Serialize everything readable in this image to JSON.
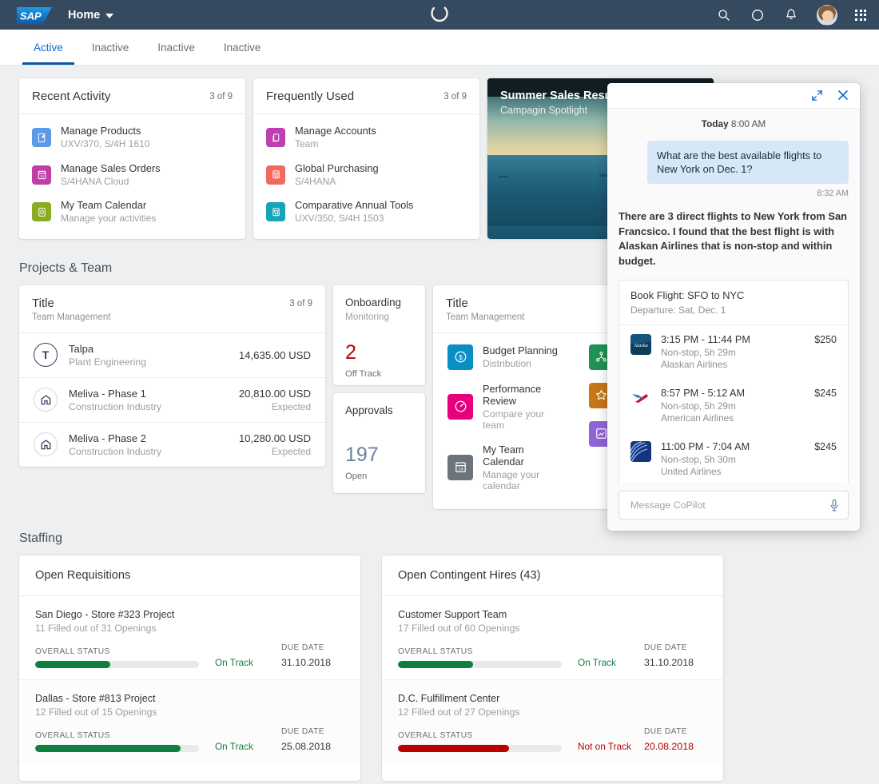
{
  "shellbar": {
    "logo_text": "SAP",
    "home_label": "Home",
    "icons": {
      "search": "search-icon",
      "circle": "circle-icon",
      "bell": "notification-bell-icon",
      "avatar": "user-avatar",
      "grid": "app-grid-icon",
      "spinner": "loading-spinner-icon"
    },
    "colors": {
      "background": "#354a5f",
      "accent": "#0a6ed1"
    }
  },
  "tabs": [
    {
      "label": "Active",
      "active": true
    },
    {
      "label": "Inactive",
      "active": false
    },
    {
      "label": "Inactive",
      "active": false
    },
    {
      "label": "Inactive",
      "active": false
    }
  ],
  "recent_activity": {
    "title": "Recent Activity",
    "count": "3 of 9",
    "items": [
      {
        "title": "Manage Products",
        "sub": "UXV/370, S/4H 1610",
        "color": "#5a9ae6",
        "icon": "document-edit-icon"
      },
      {
        "title": "Manage Sales Orders",
        "sub": "S/4HANA Cloud",
        "color": "#c13fa4",
        "icon": "calendar-icon"
      },
      {
        "title": "My Team Calendar",
        "sub": "Manage your activities",
        "color": "#8aad20",
        "icon": "document-lock-icon"
      }
    ]
  },
  "frequently_used": {
    "title": "Frequently Used",
    "count": "3 of 9",
    "items": [
      {
        "title": "Manage Accounts",
        "sub": "Team",
        "color": "#bf3eb1",
        "icon": "copy-document-icon"
      },
      {
        "title": "Global Purchasing",
        "sub": "S/4HANA",
        "color": "#f16a5f",
        "icon": "cart-document-icon"
      },
      {
        "title": "Comparative Annual Tools",
        "sub": "UXV/350, S/4H 1503",
        "color": "#15a5b8",
        "icon": "cart-document-icon"
      }
    ]
  },
  "campaign": {
    "title": "Summer Sales Results",
    "sub": "Campagin Spotlight"
  },
  "sections": {
    "projects_team": "Projects & Team",
    "staffing": "Staffing"
  },
  "projects": {
    "title": "Title",
    "sub": "Team Management",
    "count": "3 of 9",
    "items": [
      {
        "initial": "T",
        "icon": "initial-avatar",
        "name": "Talpa",
        "desc": "Plant Engineering",
        "value": "14,635.00 USD",
        "note": ""
      },
      {
        "initial": "",
        "icon": "home-outline-icon",
        "name": "Meliva - Phase 1",
        "desc": "Construction Industry",
        "value": "20,810.00 USD",
        "note": "Expected"
      },
      {
        "initial": "",
        "icon": "home-outline-icon",
        "name": "Meliva - Phase 2",
        "desc": "Construction Industry",
        "value": "10,280.00 USD",
        "note": "Expected"
      }
    ]
  },
  "kpis": [
    {
      "title": "Onboarding",
      "sub": "Monitoring",
      "number": "2",
      "footer": "Off Track",
      "tone": "red"
    },
    {
      "title": "Approvals",
      "sub": "",
      "number": "197",
      "footer": "Open",
      "tone": "blue"
    }
  ],
  "apps": {
    "title": "Title",
    "sub": "Team Management",
    "left_column": [
      {
        "name": "Budget Planning",
        "desc": "Distribution",
        "color": "#0a8ec4",
        "icon": "dollar-circle-icon"
      },
      {
        "name": "Performance Review",
        "desc": "Compare your team",
        "color": "#e6007e",
        "icon": "gauge-icon"
      },
      {
        "name": "My Team Calendar",
        "desc": "Manage your calendar",
        "color": "#6d737a",
        "icon": "calendar-14-icon"
      }
    ],
    "right_column": [
      {
        "name": "",
        "desc": "",
        "color": "#1f9254",
        "icon": "network-icon"
      },
      {
        "name": "",
        "desc": "",
        "color": "#c77718",
        "icon": "star-icon"
      },
      {
        "name": "",
        "desc": "",
        "color": "#9063d8",
        "icon": "chart-icon"
      }
    ]
  },
  "staffing": {
    "open_requisitions": {
      "title": "Open Requisitions",
      "items": [
        {
          "name": "San Diego - Store #323 Project",
          "sub": "11 Filled out of 31 Openings",
          "status_label": "OVERALL STATUS",
          "progress": 46,
          "bar_color": "#107e3e",
          "status": "On Track",
          "status_tone": "green",
          "due_label": "DUE DATE",
          "due_date": "31.10.2018",
          "due_tone": "normal"
        },
        {
          "name": "Dallas - Store #813 Project",
          "sub": "12 Filled out of 15 Openings",
          "status_label": "OVERALL STATUS",
          "progress": 89,
          "bar_color": "#107e3e",
          "status": "On Track",
          "status_tone": "green",
          "due_label": "DUE DATE",
          "due_date": "25.08.2018",
          "due_tone": "normal"
        }
      ]
    },
    "open_contingent_hires": {
      "title": "Open Contingent Hires (43)",
      "items": [
        {
          "name": "Customer Support Team",
          "sub": "17 Filled out of 60 Openings",
          "status_label": "OVERALL STATUS",
          "progress": 46,
          "bar_color": "#107e3e",
          "status": "On Track",
          "status_tone": "green",
          "due_label": "DUE DATE",
          "due_date": "31.10.2018",
          "due_tone": "normal"
        },
        {
          "name": "D.C. Fulfillment Center",
          "sub": "12 Filled out of 27 Openings",
          "status_label": "OVERALL STATUS",
          "progress": 68,
          "bar_color": "#bb0000",
          "status": "Not on Track",
          "status_tone": "red",
          "due_label": "DUE DATE",
          "due_date": "20.08.2018",
          "due_tone": "red"
        }
      ]
    }
  },
  "copilot": {
    "header_icons": {
      "expand": "expand-icon",
      "close": "close-icon"
    },
    "day_label": "Today",
    "day_time": "8:00 AM",
    "user_message": "What are the best available flights to New York on Dec. 1?",
    "user_message_time": "8:32 AM",
    "answer": "There are 3 direct flights to New York from San Francsico. I found that the best flight is with Alaskan Airlines that is non-stop and within budget.",
    "flight_card": {
      "title": "Book Flight: SFO to NYC",
      "sub": "Departure: Sat, Dec. 1",
      "flights": [
        {
          "times": "3:15 PM - 11:44 PM",
          "detail": "Non-stop, 5h 29m",
          "airline": "Alaskan Airlines",
          "price": "$250",
          "logo": "alaska-airlines-logo"
        },
        {
          "times": "8:57 PM - 5:12 AM",
          "detail": "Non-stop, 5h 29m",
          "airline": "American Airlines",
          "price": "$245",
          "logo": "american-airlines-logo"
        },
        {
          "times": "11:00 PM - 7:04 AM",
          "detail": "Non-stop, 5h 30m",
          "airline": "United Airlines",
          "price": "$245",
          "logo": "united-airlines-logo"
        }
      ]
    },
    "input_placeholder": "Message CoPilot",
    "mic_icon": "microphone-icon"
  }
}
